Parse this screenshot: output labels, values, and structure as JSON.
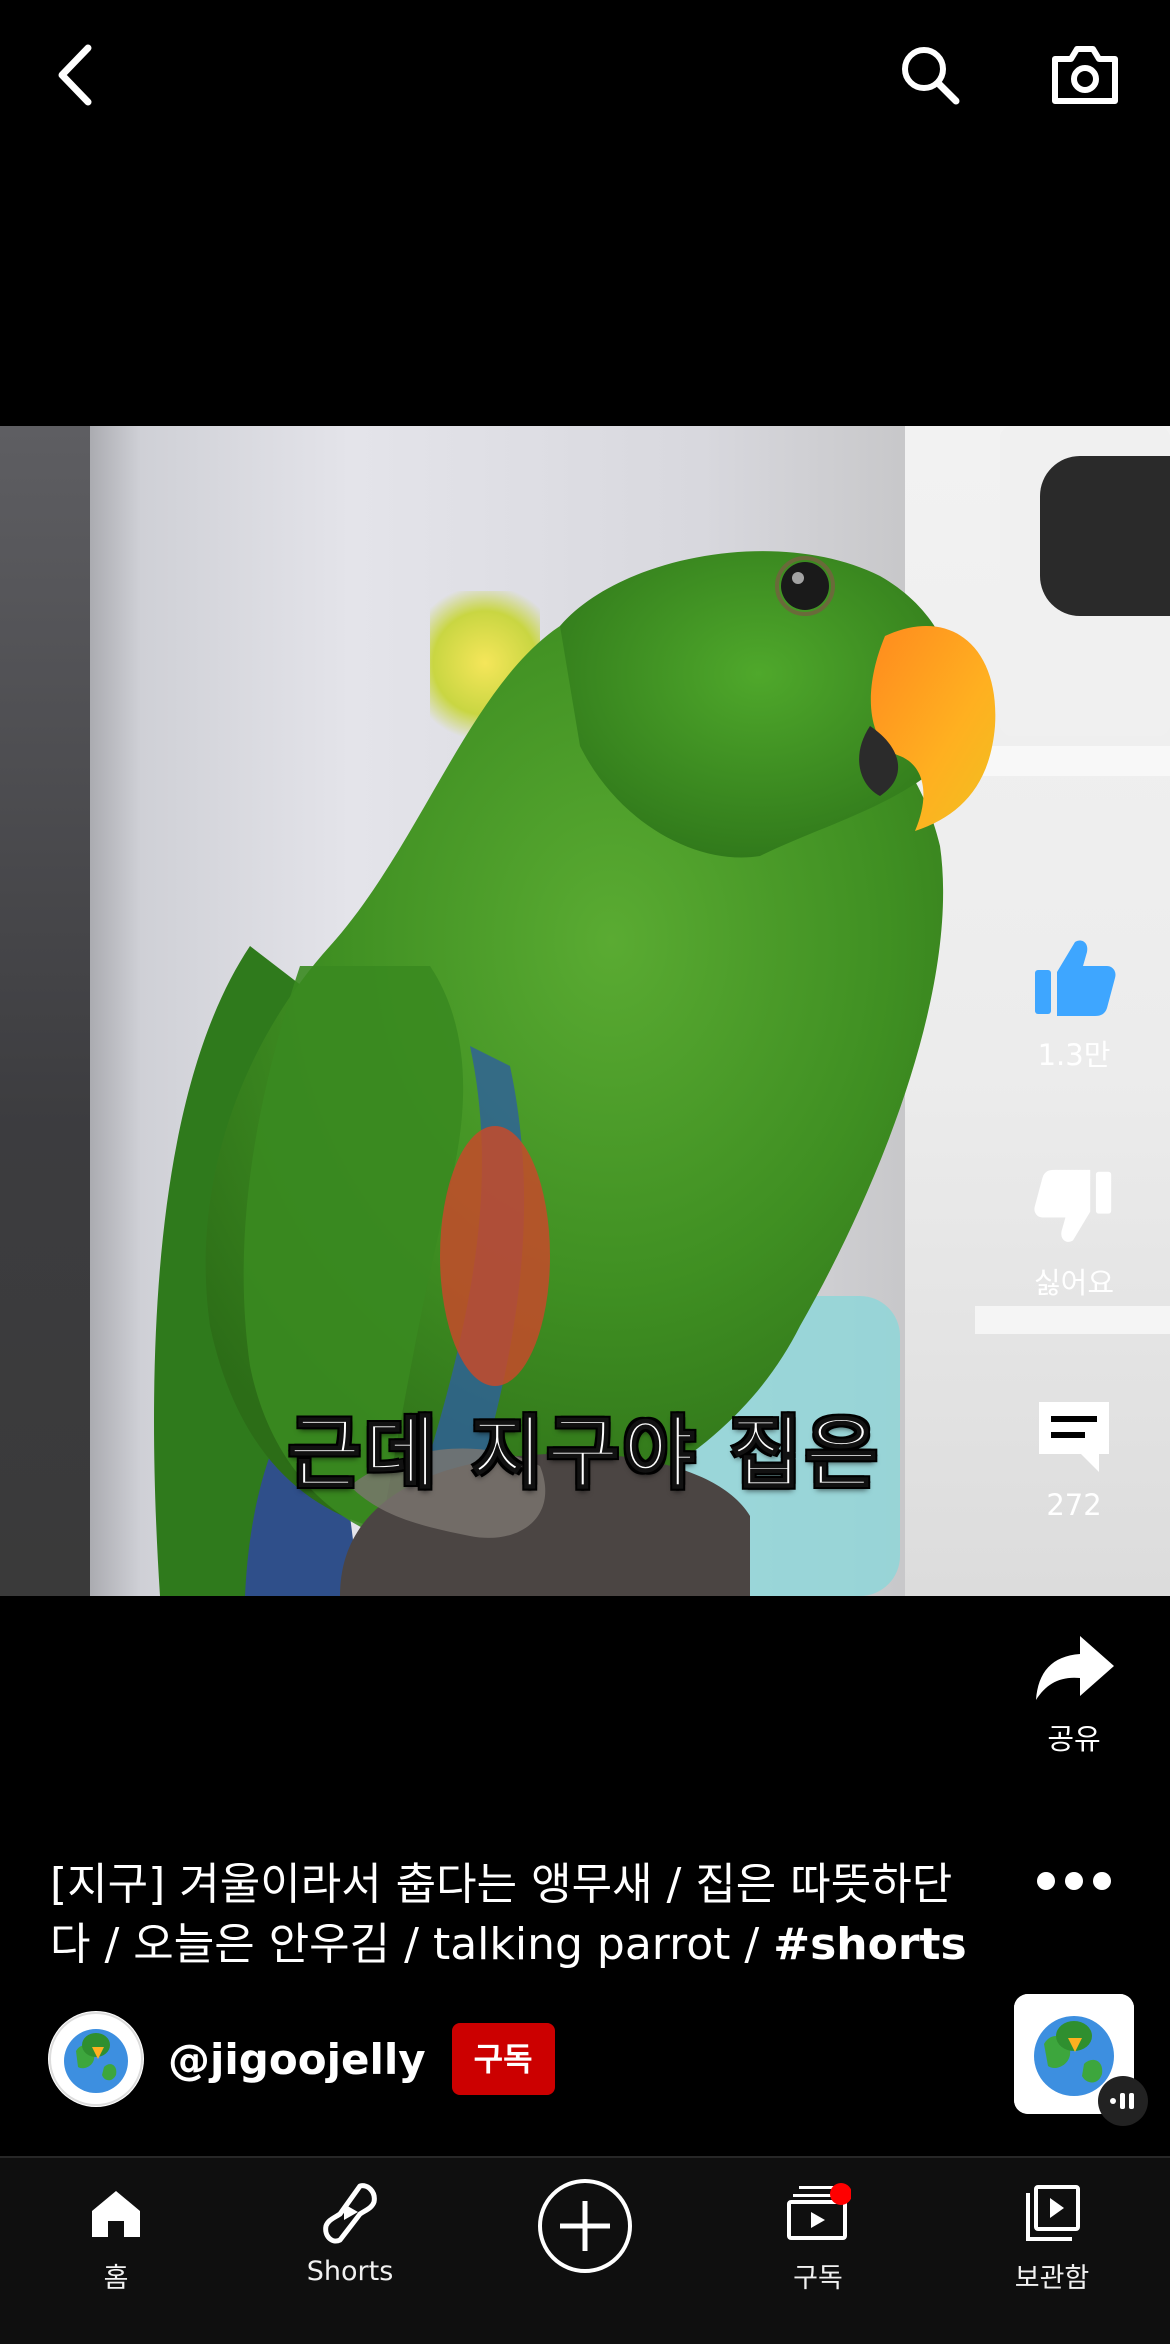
{
  "video": {
    "subtitle": "근데 지구야 집은"
  },
  "actions": {
    "like_count": "1.3만",
    "dislike_label": "싫어요",
    "comment_count": "272",
    "share_label": "공유"
  },
  "description": {
    "title_text": "[지구] 겨울이라서 춥다는 앵무새 / 집은 따뜻하단다 / 오늘은 안우김 / talking parrot / ",
    "hashtag": "#shorts"
  },
  "channel": {
    "handle": "@jigoojelly",
    "subscribe_label": "구독"
  },
  "nav": {
    "home": "홈",
    "shorts": "Shorts",
    "subscriptions": "구독",
    "library": "보관함"
  },
  "colors": {
    "like_blue": "#3ea6ff",
    "subscribe_red": "#cc0000",
    "notification_dot": "#ff0000"
  },
  "icons": [
    "back-icon",
    "search-icon",
    "camera-icon",
    "thumbs-up-icon",
    "thumbs-down-icon",
    "comment-icon",
    "share-icon",
    "more-icon",
    "home-icon",
    "shorts-icon",
    "create-icon",
    "subscriptions-icon",
    "library-icon"
  ]
}
